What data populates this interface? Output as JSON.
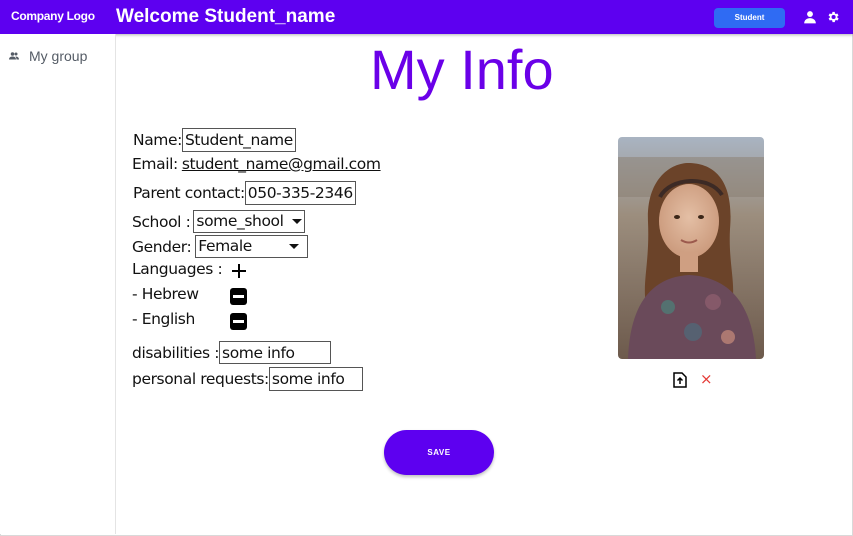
{
  "header": {
    "logo": "Company Logo",
    "welcome": "Welcome Student_name",
    "role_button": "Student",
    "bg_color": "#5d00f0"
  },
  "sidebar": {
    "items": [
      {
        "label": "My group",
        "icon": "group-icon"
      }
    ]
  },
  "page": {
    "title": "My Info",
    "title_color": "#6a00e8"
  },
  "form": {
    "name_label": "Name:",
    "name_value": "Student_name",
    "email_label": "Email:",
    "email_value": "student_name@gmail.com",
    "parent_label": "Parent contact:",
    "parent_value": "050-335-2346",
    "school_label": "School :",
    "school_value": "some_shool",
    "gender_label": "Gender:",
    "gender_value": "Female",
    "languages_label": "Languages :",
    "languages": [
      "- Hebrew",
      "- English"
    ],
    "disabilities_label": "disabilities :",
    "disabilities_value": "some info",
    "requests_label": "personal requests:",
    "requests_value": "some info"
  },
  "photo": {
    "remove_symbol": "×",
    "remove_color": "#e53935"
  },
  "actions": {
    "save_label": "SAVE"
  }
}
